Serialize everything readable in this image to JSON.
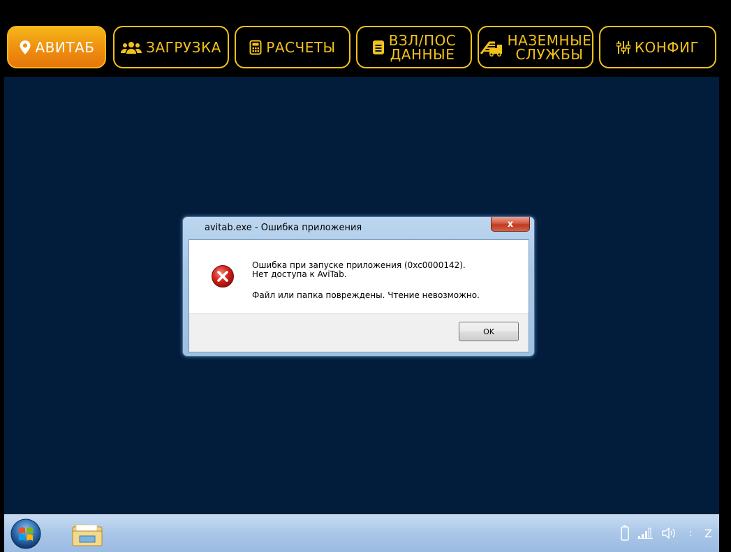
{
  "tabs": [
    {
      "label": "АВИТАБ",
      "icon": "location-pin-icon",
      "active": true
    },
    {
      "label": "ЗАГРУЗКА",
      "icon": "users-icon",
      "active": false
    },
    {
      "label": "РАСЧЕТЫ",
      "icon": "calculator-icon",
      "active": false
    },
    {
      "label_line1": "ВЗЛ/ПОС",
      "label_line2": "ДАННЫЕ",
      "icon": "document-icon",
      "active": false
    },
    {
      "label_line1": "НАЗЕМНЫЕ",
      "label_line2": "СЛУЖБЫ",
      "icon": "stairs-truck-icon",
      "active": false
    },
    {
      "label": "КОНФИГ",
      "icon": "sliders-icon",
      "active": false
    }
  ],
  "dialog": {
    "title": "avitab.exe - Ошибка приложения",
    "close_label": "x",
    "message_line1": "Ошибка при запуске приложения (0xc0000142).",
    "message_line2": "Нет доступа к AviTab.",
    "message_line3": "Файл или папка повреждены. Чтение невозможно.",
    "ok_label": "OK",
    "icon": "error-icon"
  },
  "taskbar": {
    "start_icon": "windows-start-icon",
    "pinned": [
      "file-explorer-icon"
    ],
    "tray": {
      "icons": [
        "battery-icon",
        "signal-icon",
        "volume-icon"
      ],
      "separator": ":",
      "clock_text": "Z"
    }
  },
  "colors": {
    "accent": "#f2c21a",
    "active_tab": "#ee8e10",
    "desktop_bg": "#021c3b",
    "taskbar": "#a9c6e8"
  }
}
